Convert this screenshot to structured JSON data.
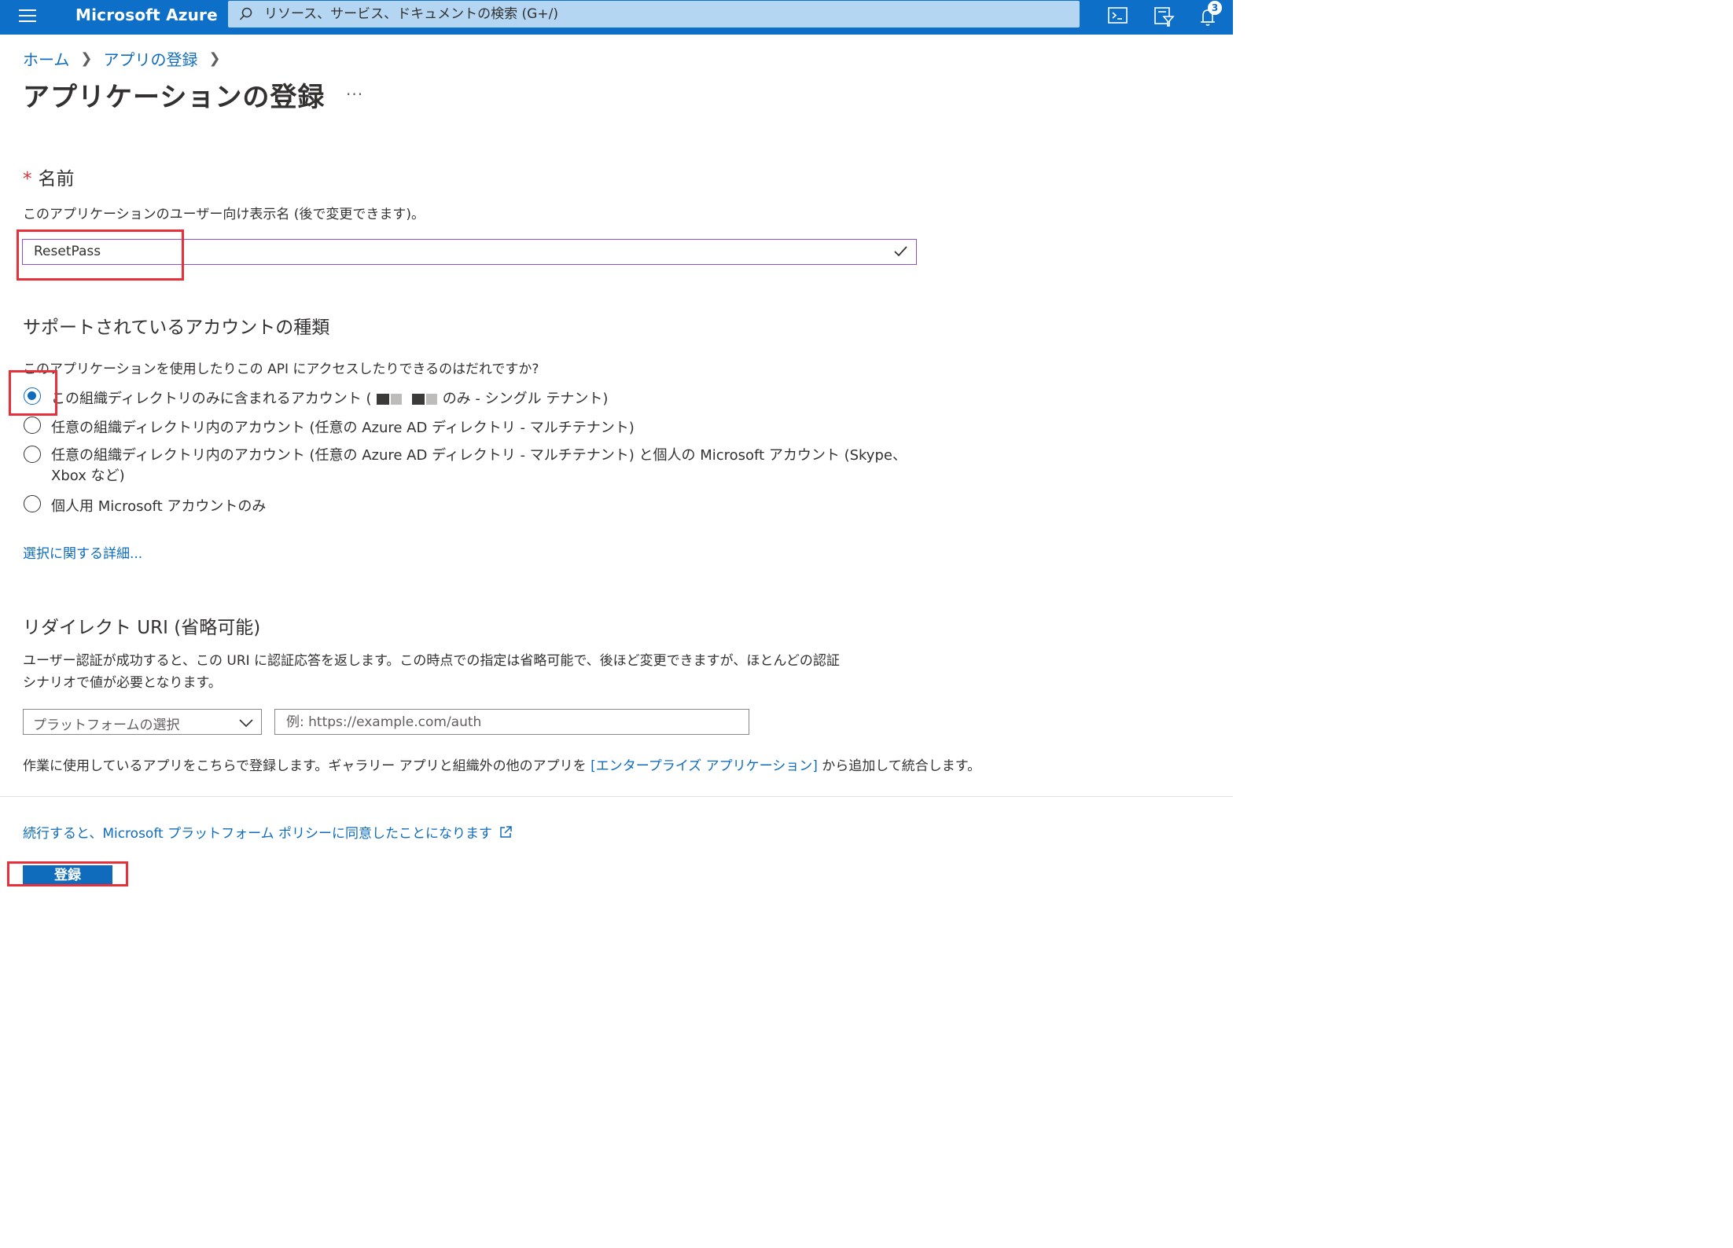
{
  "header": {
    "brand": "Microsoft Azure",
    "search_placeholder": "リソース、サービス、ドキュメントの検索 (G+/)",
    "notification_count": "3",
    "icons": [
      "menu-icon",
      "search-icon",
      "cloud-shell-icon",
      "directory-filter-icon",
      "notification-bell-icon"
    ],
    "accent_color": "#0e6fc8"
  },
  "breadcrumb": {
    "items": [
      "ホーム",
      "アプリの登録"
    ]
  },
  "page": {
    "title": "アプリケーションの登録",
    "more": "···"
  },
  "name_section": {
    "label": "名前",
    "required_mark": "*",
    "description": "このアプリケーションのユーザー向け表示名 (後で変更できます)。",
    "value": "ResetPass"
  },
  "account_section": {
    "heading": "サポートされているアカウントの種類",
    "question": "このアプリケーションを使用したりこの API にアクセスしたりできるのはだれですか?",
    "option1_prefix": "この組織ディレクトリのみに含まれるアカウント (",
    "option1_suffix": "のみ - シングル テナント)",
    "option2": "任意の組織ディレクトリ内のアカウント (任意の Azure AD ディレクトリ - マルチテナント)",
    "option3_line1": "任意の組織ディレクトリ内のアカウント (任意の Azure AD ディレクトリ - マルチテナント) と個人の Microsoft アカウント (Skype、",
    "option3_line2": "Xbox など)",
    "option4": "個人用 Microsoft アカウントのみ",
    "selected_index": 0,
    "details_link": "選択に関する詳細..."
  },
  "redirect_section": {
    "heading": "リダイレクト URI (省略可能)",
    "description_line1": "ユーザー認証が成功すると、この URI に認証応答を返します。この時点での指定は省略可能で、後ほど変更できますが、ほとんどの認証",
    "description_line2": "シナリオで値が必要となります。",
    "platform_select": "プラットフォームの選択",
    "uri_placeholder": "例: https://example.com/auth",
    "note_prefix": "作業に使用しているアプリをこちらで登録します。ギャラリー アプリと組織外の他のアプリを ",
    "note_link": "[エンタープライズ アプリケーション]",
    "note_suffix": " から追加して統合します。"
  },
  "footer": {
    "policy_link": "続行すると、Microsoft プラットフォーム ポリシーに同意したことになります",
    "register_button": "登録"
  },
  "highlight_color": "#e8303a"
}
